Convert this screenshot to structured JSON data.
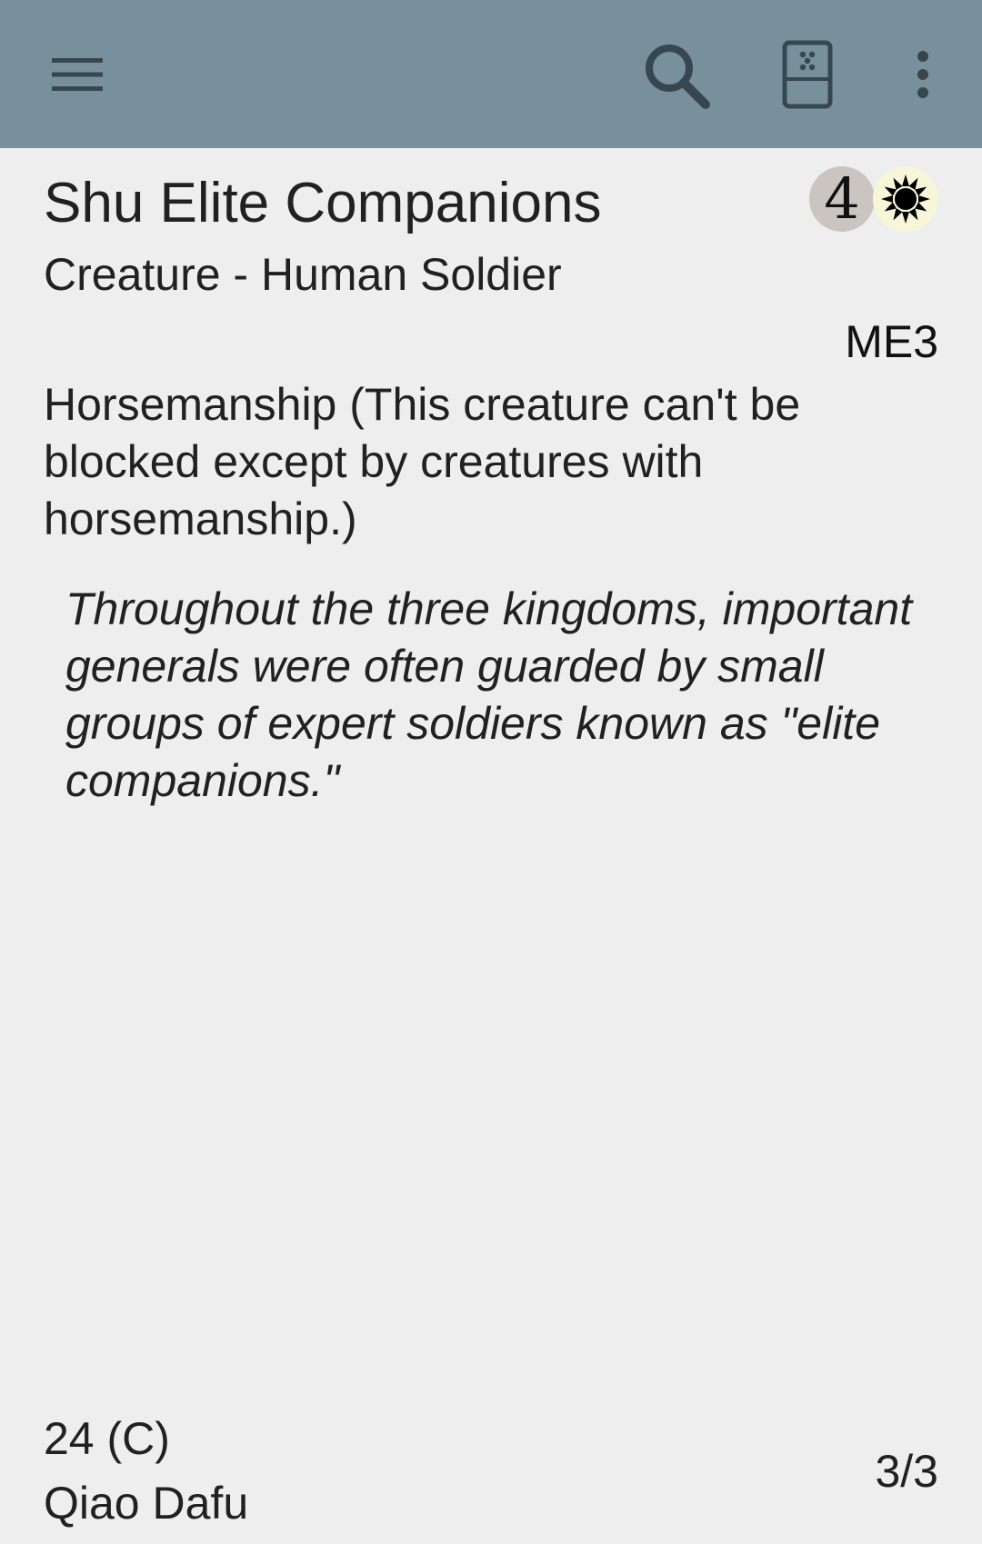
{
  "toolbar": {
    "background": "#78909c",
    "icons": [
      "menu-icon",
      "search-icon",
      "deck-icon",
      "more-vert-icon"
    ]
  },
  "card": {
    "name": "Shu Elite Companions",
    "type_line": "Creature - Human Soldier",
    "mana_cost": {
      "generic": "4",
      "colored": [
        "white-mana-icon"
      ]
    },
    "set_code": "ME3",
    "rules_text": "Horsemanship (This creature can't be blocked except by creatures with horsemanship.)",
    "flavor_text": "Throughout the three kingdoms, important generals were often guarded by small groups of expert soldiers known as \"elite companions.\"",
    "collector_number": "24 (C)",
    "artist": "Qiao Dafu",
    "power_toughness": "3/3"
  }
}
